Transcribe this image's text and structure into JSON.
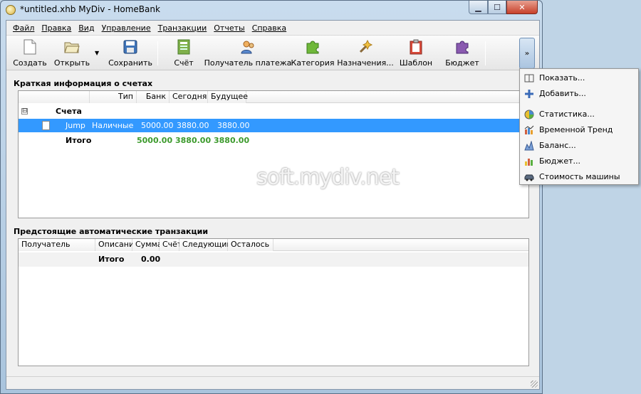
{
  "window": {
    "title": "*untitled.xhb MyDiv - HomeBank"
  },
  "menubar": {
    "items": [
      "Файл",
      "Правка",
      "Вид",
      "Управление",
      "Транзакции",
      "Отчеты",
      "Справка"
    ]
  },
  "toolbar": {
    "new_label": "Создать",
    "open_label": "Открыть",
    "save_label": "Сохранить",
    "account_label": "Счёт",
    "payee_label": "Получатель платежа",
    "category_label": "Категория",
    "assign_label": "Назначения...",
    "template_label": "Шаблон",
    "budget_label": "Бюджет",
    "overflow_label": "»"
  },
  "accounts_summary": {
    "title": "Краткая информация о счетах",
    "columns": [
      "Тип",
      "Банк",
      "Сегодня",
      "Будущее"
    ],
    "group_label": "Счета",
    "group_expander": "⊟",
    "rows": [
      {
        "name": "Jump",
        "type": "Наличные",
        "bank": "5000.00",
        "today": "3880.00",
        "future": "3880.00"
      }
    ],
    "total": {
      "label": "Итого",
      "bank": "5000.00",
      "today": "3880.00",
      "future": "3880.00"
    }
  },
  "scheduled": {
    "title": "Предстоящие автоматические транзакции",
    "columns": [
      "Получатель платежа",
      "Описание",
      "Сумма",
      "Счёт",
      "Следующий:",
      "Осталось"
    ],
    "sort_indicator": "▲",
    "total": {
      "label": "Итого",
      "amount": "0.00"
    }
  },
  "watermark": "soft.mydiv.net",
  "dropdown": {
    "items": [
      {
        "label": "Показать...",
        "icon": "book-icon"
      },
      {
        "label": "Добавить...",
        "icon": "plus-icon"
      },
      {
        "label": "Статистика...",
        "icon": "pie-chart-icon"
      },
      {
        "label": "Временной Тренд",
        "icon": "trend-chart-icon"
      },
      {
        "label": "Баланс...",
        "icon": "balance-chart-icon"
      },
      {
        "label": "Бюджет...",
        "icon": "budget-chart-icon"
      },
      {
        "label": "Стоимость машины",
        "icon": "car-icon"
      }
    ]
  },
  "colors": {
    "selection": "#3399ff",
    "positive_amount": "#3c9a2c",
    "accent": "#6e8fb5"
  }
}
